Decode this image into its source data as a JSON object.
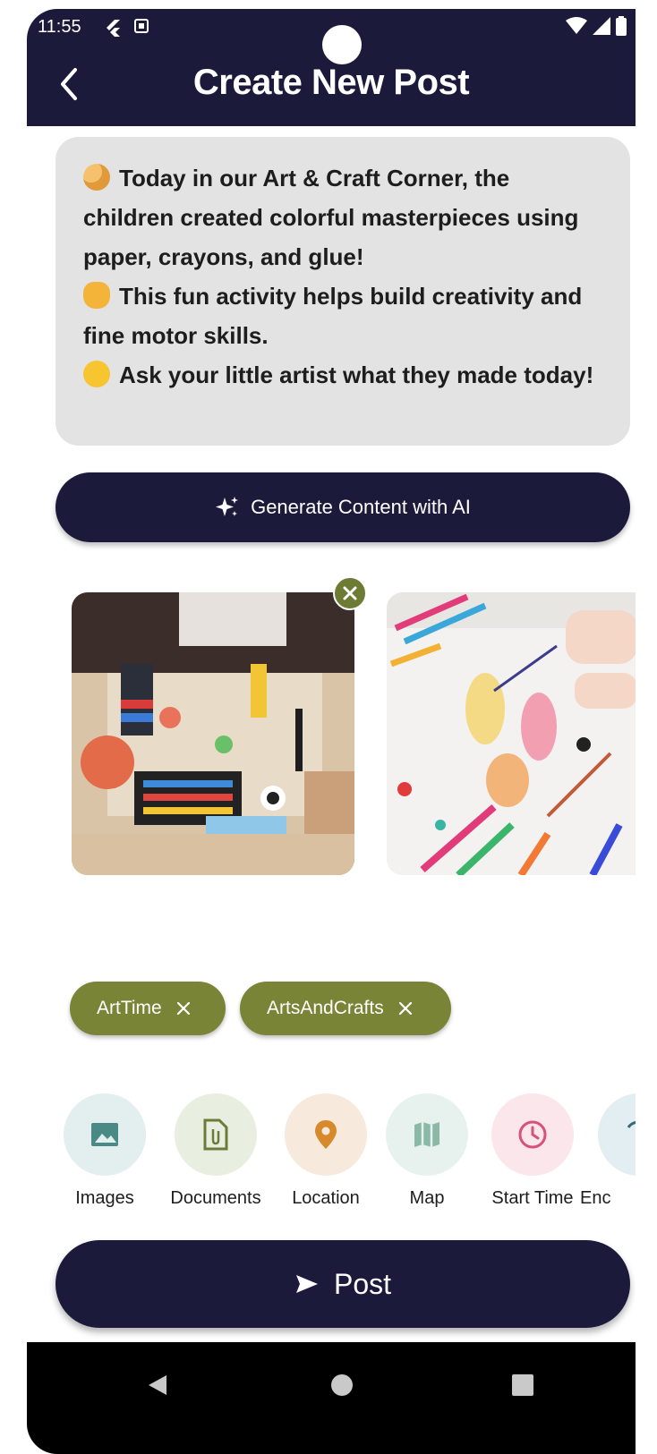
{
  "status_bar": {
    "time": "11:55"
  },
  "header": {
    "title": "Create New Post"
  },
  "post_text": {
    "lines": [
      {
        "emoji": "palette",
        "text": "Today in our Art & Craft Corner, the children created colorful masterpieces using paper, crayons, and glue!"
      },
      {
        "emoji": "raised-hand",
        "text": "This fun activity helps build creativity and fine motor skills."
      },
      {
        "emoji": "yellow-heart",
        "text": "Ask your little artist what they made today!"
      }
    ]
  },
  "ai_button": {
    "label": "Generate Content with AI"
  },
  "photos": [
    "craft-table-photo",
    "children-drawing-photo"
  ],
  "tags": [
    {
      "label": "ArtTime"
    },
    {
      "label": "ArtsAndCrafts"
    }
  ],
  "attachments": [
    {
      "label": "Images",
      "icon": "image-icon",
      "bg": "#e3eeee",
      "color": "#4a8a86"
    },
    {
      "label": "Documents",
      "icon": "document-icon",
      "bg": "#e9efe0",
      "color": "#6c7c38"
    },
    {
      "label": "Location",
      "icon": "location-pin-icon",
      "bg": "#f7eadd",
      "color": "#d68a2b"
    },
    {
      "label": "Map",
      "icon": "map-icon",
      "bg": "#e7f2ee",
      "color": "#8cb9a6"
    },
    {
      "label": "Start Time",
      "icon": "clock-icon",
      "bg": "#fbe6ec",
      "color": "#d6517c"
    },
    {
      "label": "Enc",
      "icon": "end-time-icon",
      "bg": "#e3eef3",
      "color": "#3a6a7a"
    }
  ],
  "post_button": {
    "label": "Post"
  },
  "colors": {
    "primary": "#1c1a3b",
    "chip": "#7a8436",
    "text_box": "#e3e3e3"
  }
}
